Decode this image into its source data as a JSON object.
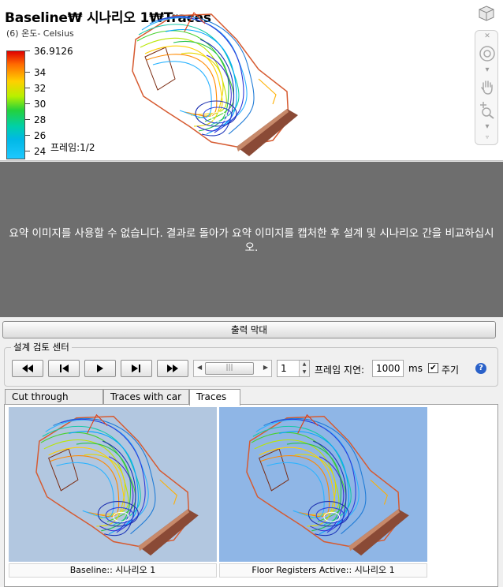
{
  "viewport": {
    "title": "Baseline₩ 시나리오 1₩Traces",
    "subtitle": "(6) 온도- Celsius",
    "legend": {
      "max": "36.9126",
      "ticks": [
        "34",
        "32",
        "30",
        "28",
        "26",
        "24"
      ]
    },
    "frame_label": "프레임:1/2"
  },
  "summary": {
    "message": "요약 이미지를 사용할 수 없습니다. 결과로 돌아가 요약 이미지를 캡처한 후 설계 및 시나리오 간을 비교하십시오."
  },
  "output_bar": {
    "label": "출력 막대"
  },
  "review": {
    "title": "설계 검토 센터",
    "frame_value": "1",
    "delay_label": "프레임 지연:",
    "delay_value": "1000",
    "ms_label": "ms",
    "cycle_label": "주기",
    "cycle_checked": true
  },
  "tabs": [
    {
      "label": "Cut through seats",
      "active": false
    },
    {
      "label": "Traces with car",
      "active": false
    },
    {
      "label": "Traces",
      "active": true
    }
  ],
  "thumbnails": [
    {
      "caption": "Baseline:: 시나리오 1",
      "bg": "#b2c7e0"
    },
    {
      "caption": "Floor Registers Active:: 시나리오 1",
      "bg": "#8fb6e6"
    }
  ],
  "colors": {
    "viewport_bg": "#ffffff",
    "summary_bg": "#6e6e6e",
    "help": "#2a61c9"
  }
}
